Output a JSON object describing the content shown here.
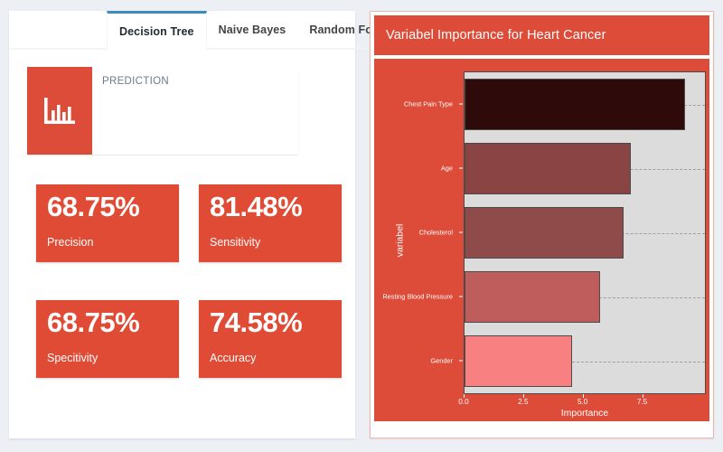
{
  "theme": {
    "page_background": "#ecf0f5",
    "accent_red": "#dd4b39",
    "card_red": "#e04b35",
    "active_tab_underline": "#3c8dbc",
    "plot_panel_background": "#dcdcdc"
  },
  "left_panel": {
    "tabs": [
      {
        "label": "Decision Tree",
        "active": true
      },
      {
        "label": "Naive Bayes",
        "active": false
      },
      {
        "label": "Random Forest",
        "active": false
      }
    ],
    "prediction_box": {
      "icon": "bar-chart-icon",
      "label": "PREDICTION"
    },
    "metrics": [
      {
        "value": "68.75%",
        "label": "Precision"
      },
      {
        "value": "81.48%",
        "label": "Sensitivity"
      },
      {
        "value": "68.75%",
        "label": "Specitivity"
      },
      {
        "value": "74.58%",
        "label": "Accuracy"
      }
    ]
  },
  "right_panel": {
    "title": "Variabel Importance for Heart Cancer"
  },
  "chart_data": {
    "type": "bar",
    "orientation": "horizontal",
    "title": "Variabel Importance for Heart Cancer",
    "xlabel": "Importance",
    "ylabel": "variabel",
    "xlim": [
      0,
      10.1
    ],
    "xticks": [
      "0.0",
      "2.5",
      "5.0",
      "7.5"
    ],
    "xtick_values": [
      0.0,
      2.5,
      5.0,
      7.5
    ],
    "grid": true,
    "grid_style": "dashed",
    "legend": false,
    "categories": [
      "Chest Pain Type",
      "Age",
      "Cholesterol",
      "Resting Blood Pressure",
      "Gender"
    ],
    "values": [
      9.25,
      7.0,
      6.7,
      5.7,
      4.5
    ],
    "bar_colors": [
      "#2e0a0a",
      "#8b4444",
      "#8f4a4a",
      "#bf5c5c",
      "#f88080"
    ]
  }
}
